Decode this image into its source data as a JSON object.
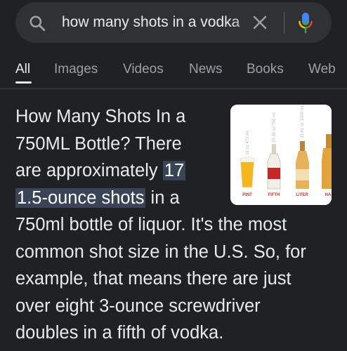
{
  "search": {
    "query": "how many shots in a vodka",
    "icon": "search-icon",
    "clear_icon": "close-icon",
    "mic_icon": "microphone-icon"
  },
  "tabs": [
    {
      "label": "All",
      "active": true
    },
    {
      "label": "Images",
      "active": false
    },
    {
      "label": "Videos",
      "active": false
    },
    {
      "label": "News",
      "active": false
    },
    {
      "label": "Books",
      "active": false
    },
    {
      "label": "Web",
      "active": false
    }
  ],
  "snippet": {
    "line1": "How Many Shots In a",
    "line2": "750ML Bottle? There",
    "line3_plain": "are approximately ",
    "line3_highlight": "17",
    "line4_highlight": "1.5-ounce shots",
    "line4_plain": " in a",
    "line5": "750ml bottle of liquor. It's the most",
    "line6": "common shot size in the U.S. So, for",
    "line7": "example, that means there are just",
    "line8": "over eight 3-ounce screwdriver",
    "line9": "doubles in a fifth of vodka."
  },
  "thumbnail": {
    "labels": [
      "PINT",
      "FIFTH",
      "LITER",
      "HA"
    ],
    "vertical_labels": [
      "16 oz 473 ml",
      "25.36 oz 750 ml",
      "33.81 oz 1000 ml"
    ]
  },
  "colors": {
    "background": "#202124",
    "search_bg": "#303134",
    "text": "#e8eaed",
    "muted": "#9aa0a6",
    "highlight": "#394457"
  }
}
